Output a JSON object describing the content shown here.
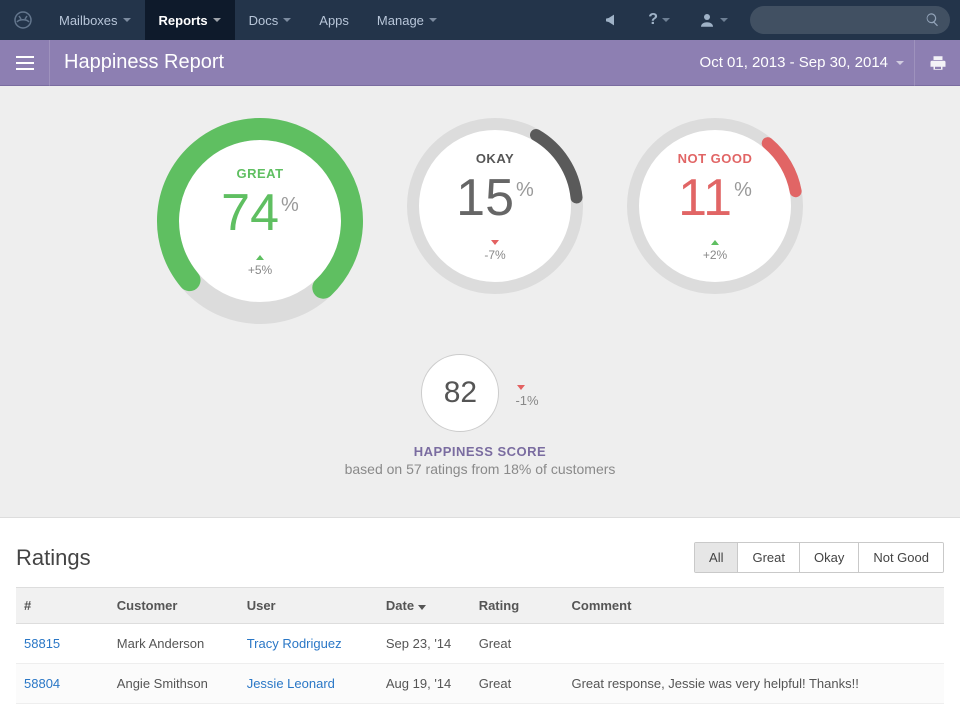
{
  "nav": {
    "items": [
      {
        "label": "Mailboxes",
        "dropdown": true,
        "active": false
      },
      {
        "label": "Reports",
        "dropdown": true,
        "active": true
      },
      {
        "label": "Docs",
        "dropdown": true,
        "active": false
      },
      {
        "label": "Apps",
        "dropdown": false,
        "active": false
      },
      {
        "label": "Manage",
        "dropdown": true,
        "active": false
      }
    ],
    "help_symbol": "?"
  },
  "subbar": {
    "title": "Happiness Report",
    "date_range": "Oct 01, 2013 - Sep 30, 2014"
  },
  "chart_data": {
    "type": "pie",
    "title": "Happiness Report",
    "gauges": [
      {
        "key": "great",
        "label": "GREAT",
        "value": 74,
        "delta": "+5%",
        "delta_dir": "up",
        "color": "#5fbf61"
      },
      {
        "key": "okay",
        "label": "OKAY",
        "value": 15,
        "delta": "-7%",
        "delta_dir": "down",
        "color": "#5a5a5a"
      },
      {
        "key": "notgood",
        "label": "NOT GOOD",
        "value": 11,
        "delta": "+2%",
        "delta_dir": "up",
        "color": "#e16565"
      }
    ],
    "score": {
      "value": "82",
      "delta": "-1%",
      "delta_dir": "down",
      "label": "HAPPINESS SCORE",
      "subtext": "based on 57 ratings from 18% of customers"
    }
  },
  "ratings": {
    "title": "Ratings",
    "filters": [
      {
        "label": "All",
        "active": true
      },
      {
        "label": "Great",
        "active": false
      },
      {
        "label": "Okay",
        "active": false
      },
      {
        "label": "Not Good",
        "active": false
      }
    ],
    "columns": [
      "#",
      "Customer",
      "User",
      "Date",
      "Rating",
      "Comment"
    ],
    "sort_col": "Date",
    "rows": [
      {
        "id": "58815",
        "customer": "Mark Anderson",
        "user": "Tracy Rodriguez",
        "date": "Sep 23, '14",
        "rating": "Great",
        "comment": ""
      },
      {
        "id": "58804",
        "customer": "Angie Smithson",
        "user": "Jessie Leonard",
        "date": "Aug 19, '14",
        "rating": "Great",
        "comment": "Great response, Jessie was very helpful! Thanks!!"
      }
    ]
  }
}
